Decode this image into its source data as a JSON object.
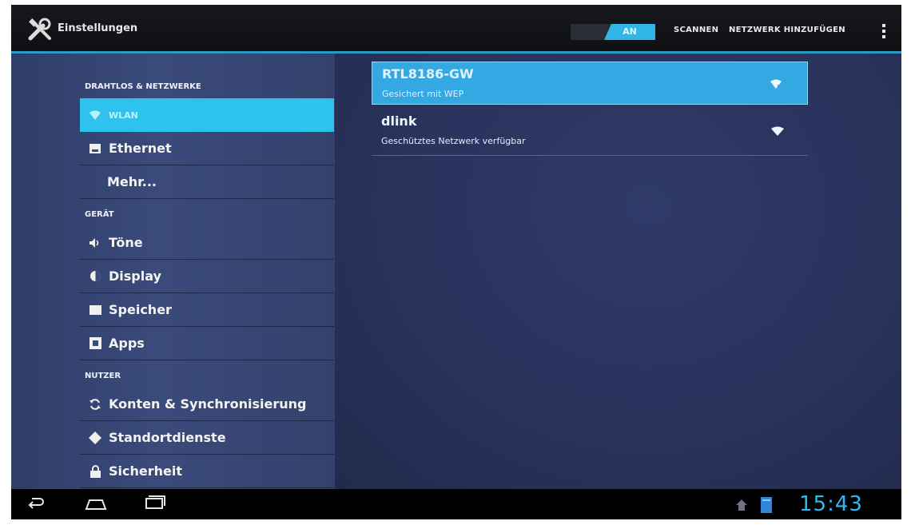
{
  "app": {
    "title": "Einstellungen",
    "icon": "settings-tools-icon"
  },
  "actionbar": {
    "wifi_toggle": "AN",
    "scan_label": "SCANNEN",
    "add_network_label": "NETZWERK HINZUFÜGEN",
    "overflow_icon": "overflow-menu-icon"
  },
  "sidebar": {
    "sections": [
      {
        "label": "DRAHTLOS & NETZWERKE"
      },
      {
        "label": "GERÄT"
      },
      {
        "label": "NUTZER"
      }
    ],
    "items": [
      {
        "label": "WLAN",
        "icon": "wifi-icon",
        "selected": true
      },
      {
        "label": "Ethernet",
        "icon": "ethernet-icon"
      },
      {
        "label": "Mehr...",
        "icon": ""
      },
      {
        "label": "Töne",
        "icon": "speaker-icon"
      },
      {
        "label": "Display",
        "icon": "display-icon"
      },
      {
        "label": "Speicher",
        "icon": "storage-icon"
      },
      {
        "label": "Apps",
        "icon": "apps-icon"
      },
      {
        "label": "Konten & Synchronisierung",
        "icon": "sync-icon"
      },
      {
        "label": "Standortdienste",
        "icon": "location-icon"
      },
      {
        "label": "Sicherheit",
        "icon": "lock-icon"
      }
    ]
  },
  "networks": [
    {
      "ssid": "RTL8186-GW",
      "status": "Gesichert mit WEP",
      "icon": "wifi-signal-locked-icon",
      "selected": true
    },
    {
      "ssid": "dlink",
      "status": "Geschütztes Netzwerk verfügbar",
      "icon": "wifi-signal-icon"
    }
  ],
  "navbar": {
    "back_icon": "back-icon",
    "home_icon": "home-icon",
    "recents_icon": "recent-apps-icon",
    "notification_icons": [
      "notification-app-icon",
      "notification-storage-icon"
    ],
    "clock": "15:43"
  },
  "colors": {
    "accent": "#31b6e7",
    "panel": "#34436f",
    "background": "#0b0d12"
  }
}
